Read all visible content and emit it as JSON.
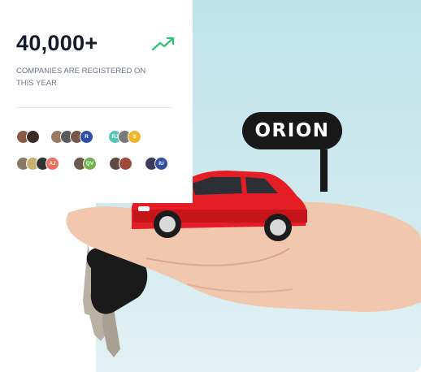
{
  "stats": {
    "number": "40,000+",
    "caption": "COMPANIES ARE REGISTERED ON THIS YEAR"
  },
  "avatar_rows": [
    [
      {
        "avatars": [
          {
            "initials": "",
            "color": "#8a5a44"
          },
          {
            "initials": "",
            "color": "#3d2b24"
          }
        ]
      },
      {
        "avatars": [
          {
            "initials": "",
            "color": "#9a7b62"
          },
          {
            "initials": "",
            "color": "#5a5a5a"
          },
          {
            "initials": "",
            "color": "#7a5548"
          },
          {
            "initials": "R",
            "color": "#2f4fa0"
          }
        ]
      },
      {
        "avatars": [
          {
            "initials": "RJ",
            "color": "#56c4b6"
          },
          {
            "initials": "",
            "color": "#7a7a7a"
          },
          {
            "initials": "S",
            "color": "#f2b42c"
          }
        ]
      }
    ],
    [
      {
        "avatars": [
          {
            "initials": "",
            "color": "#8c7a68"
          },
          {
            "initials": "",
            "color": "#c8b070"
          },
          {
            "initials": "",
            "color": "#333333"
          },
          {
            "initials": "AJ",
            "color": "#ef6f5f"
          }
        ]
      },
      {
        "avatars": [
          {
            "initials": "",
            "color": "#6d5a4c"
          },
          {
            "initials": "QV",
            "color": "#6db34a"
          }
        ]
      },
      {
        "avatars": [
          {
            "initials": "",
            "color": "#5e4a42"
          },
          {
            "initials": "",
            "color": "#a04a3a"
          }
        ]
      },
      {
        "avatars": [
          {
            "initials": "",
            "color": "#3a3a5a"
          },
          {
            "initials": "IU",
            "color": "#2f4fa0"
          }
        ]
      }
    ]
  ],
  "brand": {
    "label": "ORION"
  },
  "colors": {
    "trend": "#2fbf71",
    "car": "#e51d24",
    "background": "#cfe9ee"
  }
}
